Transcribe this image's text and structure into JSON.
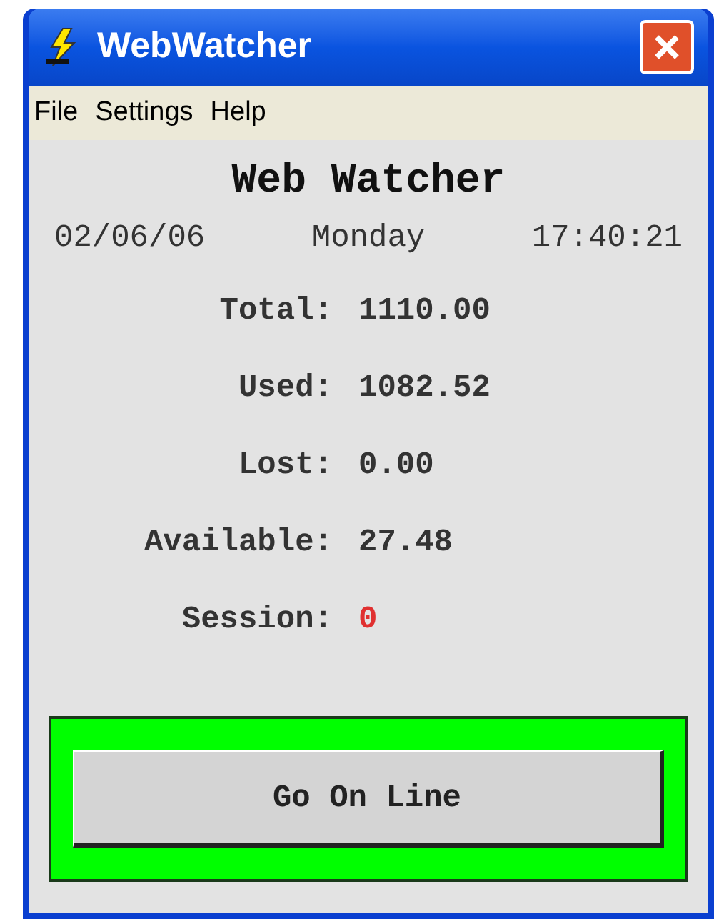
{
  "window": {
    "title": "WebWatcher"
  },
  "menu": [
    "File",
    "Settings",
    "Help"
  ],
  "heading": "Web Watcher",
  "date_row": {
    "date": "02/06/06",
    "day": "Monday",
    "time": "17:40:21"
  },
  "stats": [
    {
      "label": "Total:",
      "value": "1110.00",
      "color": "#333333"
    },
    {
      "label": "Used:",
      "value": "1082.52",
      "color": "#333333"
    },
    {
      "label": "Lost:",
      "value": "0.00",
      "color": "#333333"
    },
    {
      "label": "Available:",
      "value": "27.48",
      "color": "#333333"
    },
    {
      "label": "Session:",
      "value": "0",
      "color": "#e03030"
    }
  ],
  "online_button": {
    "label": "Go On Line",
    "color": "#00ff00"
  }
}
